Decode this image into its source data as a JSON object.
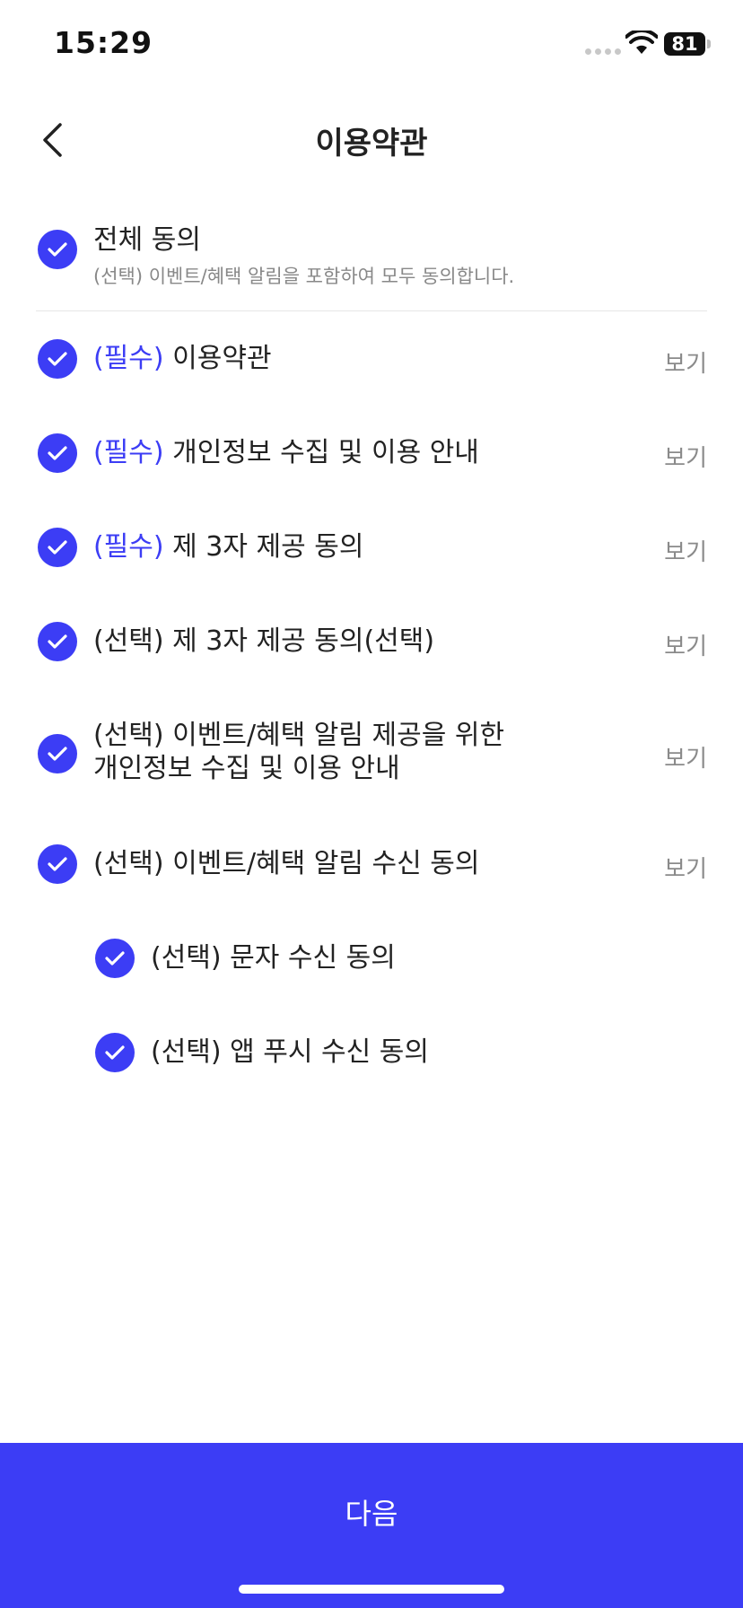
{
  "status_bar": {
    "time": "15:29",
    "battery": "81"
  },
  "header": {
    "title": "이용약관"
  },
  "all_agree": {
    "title": "전체 동의",
    "description": "(선택) 이벤트/혜택 알림을 포함하여 모두 동의합니다."
  },
  "terms": [
    {
      "prefix": "(필수)",
      "label": "이용약관",
      "view": "보기"
    },
    {
      "prefix": "(필수)",
      "label": "개인정보 수집 및 이용 안내",
      "view": "보기"
    },
    {
      "prefix": "(필수)",
      "label": "제 3자 제공 동의",
      "view": "보기"
    },
    {
      "label": "(선택) 제 3자 제공 동의(선택)",
      "view": "보기"
    },
    {
      "label_line1": "(선택) 이벤트/혜택 알림 제공을 위한",
      "label_line2": "개인정보 수집 및 이용 안내",
      "view": "보기"
    },
    {
      "label": "(선택) 이벤트/혜택 알림 수신 동의",
      "view": "보기"
    }
  ],
  "sub_terms": [
    {
      "label": "(선택) 문자 수신 동의"
    },
    {
      "label": "(선택) 앱 푸시 수신 동의"
    }
  ],
  "next_button": {
    "label": "다음"
  },
  "colors": {
    "accent": "#3c3df5",
    "muted_text": "#8a8a8a",
    "text": "#222222"
  }
}
